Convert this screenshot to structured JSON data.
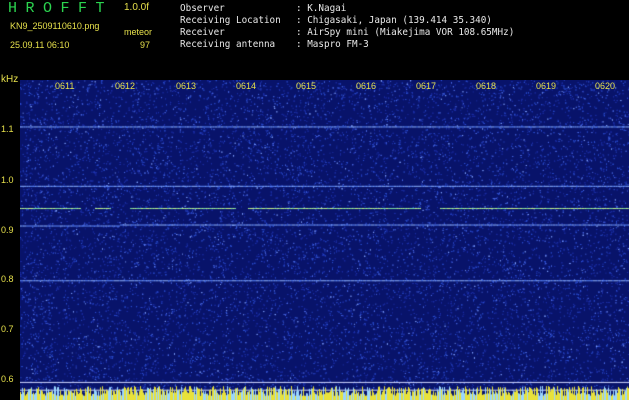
{
  "header": {
    "app_title": "HROFFT",
    "version": "1.0.0f",
    "filename": "KN9_2509110610.png",
    "mode": "meteor",
    "datetime": "25.09.11 06:10",
    "count": "97"
  },
  "station_info": [
    {
      "key": "Observer",
      "value": ": K.Nagai"
    },
    {
      "key": "Receiving Location",
      "value": ": Chigasaki, Japan (139.414 35.340)"
    },
    {
      "key": "Receiver",
      "value": ": AirSpy mini (Miakejima VOR 108.65MHz)"
    },
    {
      "key": "Receiving antenna",
      "value": ": Maspro FM-3"
    }
  ],
  "axes": {
    "y_unit": "kHz",
    "y_ticks": [
      "1.1",
      "1.0",
      "0.9",
      "0.8",
      "0.7",
      "0.6"
    ],
    "x_ticks": [
      "0611",
      "0612",
      "0613",
      "0614",
      "0615",
      "0616",
      "0617",
      "0618",
      "0619",
      "0620"
    ],
    "y_range": [
      0.58,
      1.2
    ]
  },
  "spectrogram": {
    "background_color": "#08136a",
    "noise_color": "#2a4dd0",
    "signal_lines_khz": [
      1.11,
      0.995,
      0.952,
      0.92,
      0.812,
      0.615,
      0.6,
      0.588
    ],
    "bright_line_khz": 0.952
  }
}
